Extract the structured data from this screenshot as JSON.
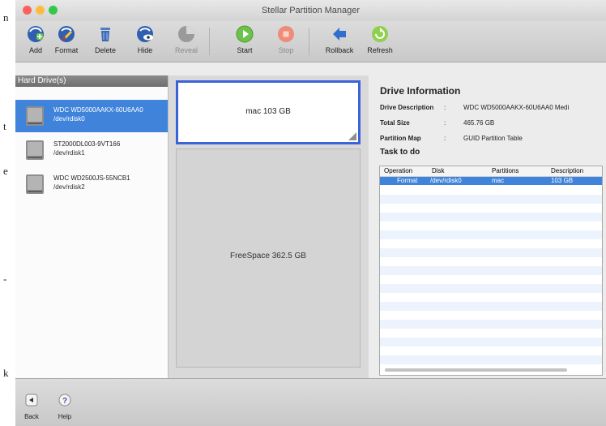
{
  "stray_margin": [
    "n",
    "t",
    "e",
    "-",
    "k"
  ],
  "window": {
    "title": "Stellar Partition Manager"
  },
  "colors": {
    "close": "#fc605b",
    "minimize": "#fdbc40",
    "zoom": "#34c84a",
    "selection": "#3f84da",
    "partition_border": "#3b63d9"
  },
  "toolbar": {
    "buttons": [
      {
        "label": "Add",
        "icon": "add-icon",
        "enabled": true
      },
      {
        "label": "Format",
        "icon": "format-icon",
        "enabled": true
      },
      {
        "label": "Delete",
        "icon": "delete-icon",
        "enabled": true
      },
      {
        "label": "Hide",
        "icon": "hide-icon",
        "enabled": true
      },
      {
        "label": "Reveal",
        "icon": "reveal-icon",
        "enabled": false
      },
      {
        "label": "Start",
        "icon": "start-icon",
        "enabled": true
      },
      {
        "label": "Stop",
        "icon": "stop-icon",
        "enabled": false
      },
      {
        "label": "Rollback",
        "icon": "rollback-icon",
        "enabled": true
      },
      {
        "label": "Refresh",
        "icon": "refresh-icon",
        "enabled": true
      }
    ]
  },
  "hard_drives": {
    "header": "Hard Drive(s)",
    "items": [
      {
        "name": "WDC WD5000AAKX-60U6AA0",
        "path": "/dev/rdisk0",
        "selected": true
      },
      {
        "name": "ST2000DL003-9VT166",
        "path": "/dev/rdisk1",
        "selected": false
      },
      {
        "name": "WDC WD2500JS-55NCB1",
        "path": "/dev/rdisk2",
        "selected": false
      }
    ]
  },
  "partitions": {
    "mac": "mac 103 GB",
    "free": "FreeSpace 362.5 GB"
  },
  "drive_info": {
    "title": "Drive Information",
    "rows": [
      {
        "key": "Drive Description",
        "value": "WDC WD5000AAKX-60U6AA0 Medi"
      },
      {
        "key": "Total Size",
        "value": "465.76 GB"
      },
      {
        "key": "Partition Map",
        "value": "GUID Partition Table"
      }
    ],
    "separator": ":"
  },
  "tasks": {
    "title": "Task to do",
    "columns": [
      "Operation",
      "Disk",
      "Partitions",
      "Description"
    ],
    "rows": [
      {
        "operation": "Format",
        "disk": "/dev/rdisk0",
        "partitions": "mac",
        "description": "103 GB"
      }
    ]
  },
  "bottom": {
    "back_label": "Back",
    "help_label": "Help"
  }
}
